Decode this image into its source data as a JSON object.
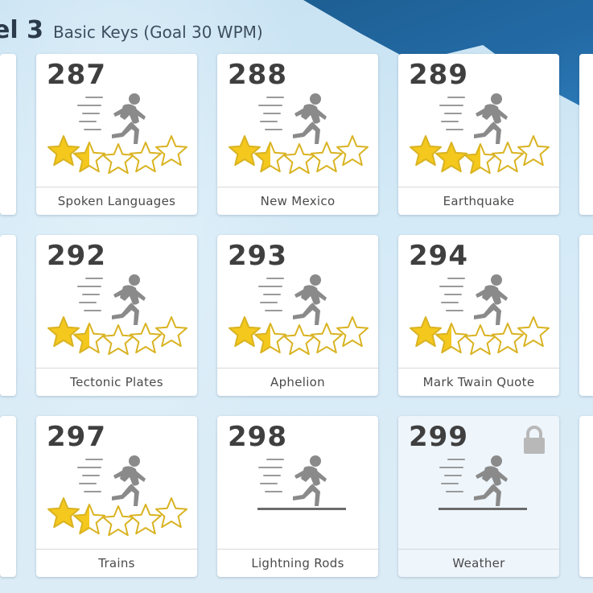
{
  "header": {
    "level": "el 3",
    "subtitle": "Basic Keys (Goal 30 WPM)"
  },
  "lessons": [
    {
      "number": "287",
      "title": "Spoken Languages",
      "stars": 1.5,
      "locked": false
    },
    {
      "number": "288",
      "title": "New Mexico",
      "stars": 1.5,
      "locked": false
    },
    {
      "number": "289",
      "title": "Earthquake",
      "stars": 2.5,
      "locked": false
    },
    {
      "number": "292",
      "title": "Tectonic Plates",
      "stars": 1.5,
      "locked": false
    },
    {
      "number": "293",
      "title": "Aphelion",
      "stars": 1.5,
      "locked": false
    },
    {
      "number": "294",
      "title": "Mark Twain Quote",
      "stars": 1.5,
      "locked": false
    },
    {
      "number": "297",
      "title": "Trains",
      "stars": 1.5,
      "locked": false
    },
    {
      "number": "298",
      "title": "Lightning Rods",
      "stars": 0,
      "locked": false
    },
    {
      "number": "299",
      "title": "Weather",
      "stars": 0,
      "locked": true
    }
  ],
  "icons": {
    "runner": "runner-icon",
    "star": "star-icon",
    "lock": "lock-icon"
  },
  "colors": {
    "star_fill": "#f4c81c",
    "star_empty": "#ffffff",
    "star_outline": "#d9b322",
    "runner": "#8a8a8a",
    "lock": "#b8b8b8"
  }
}
